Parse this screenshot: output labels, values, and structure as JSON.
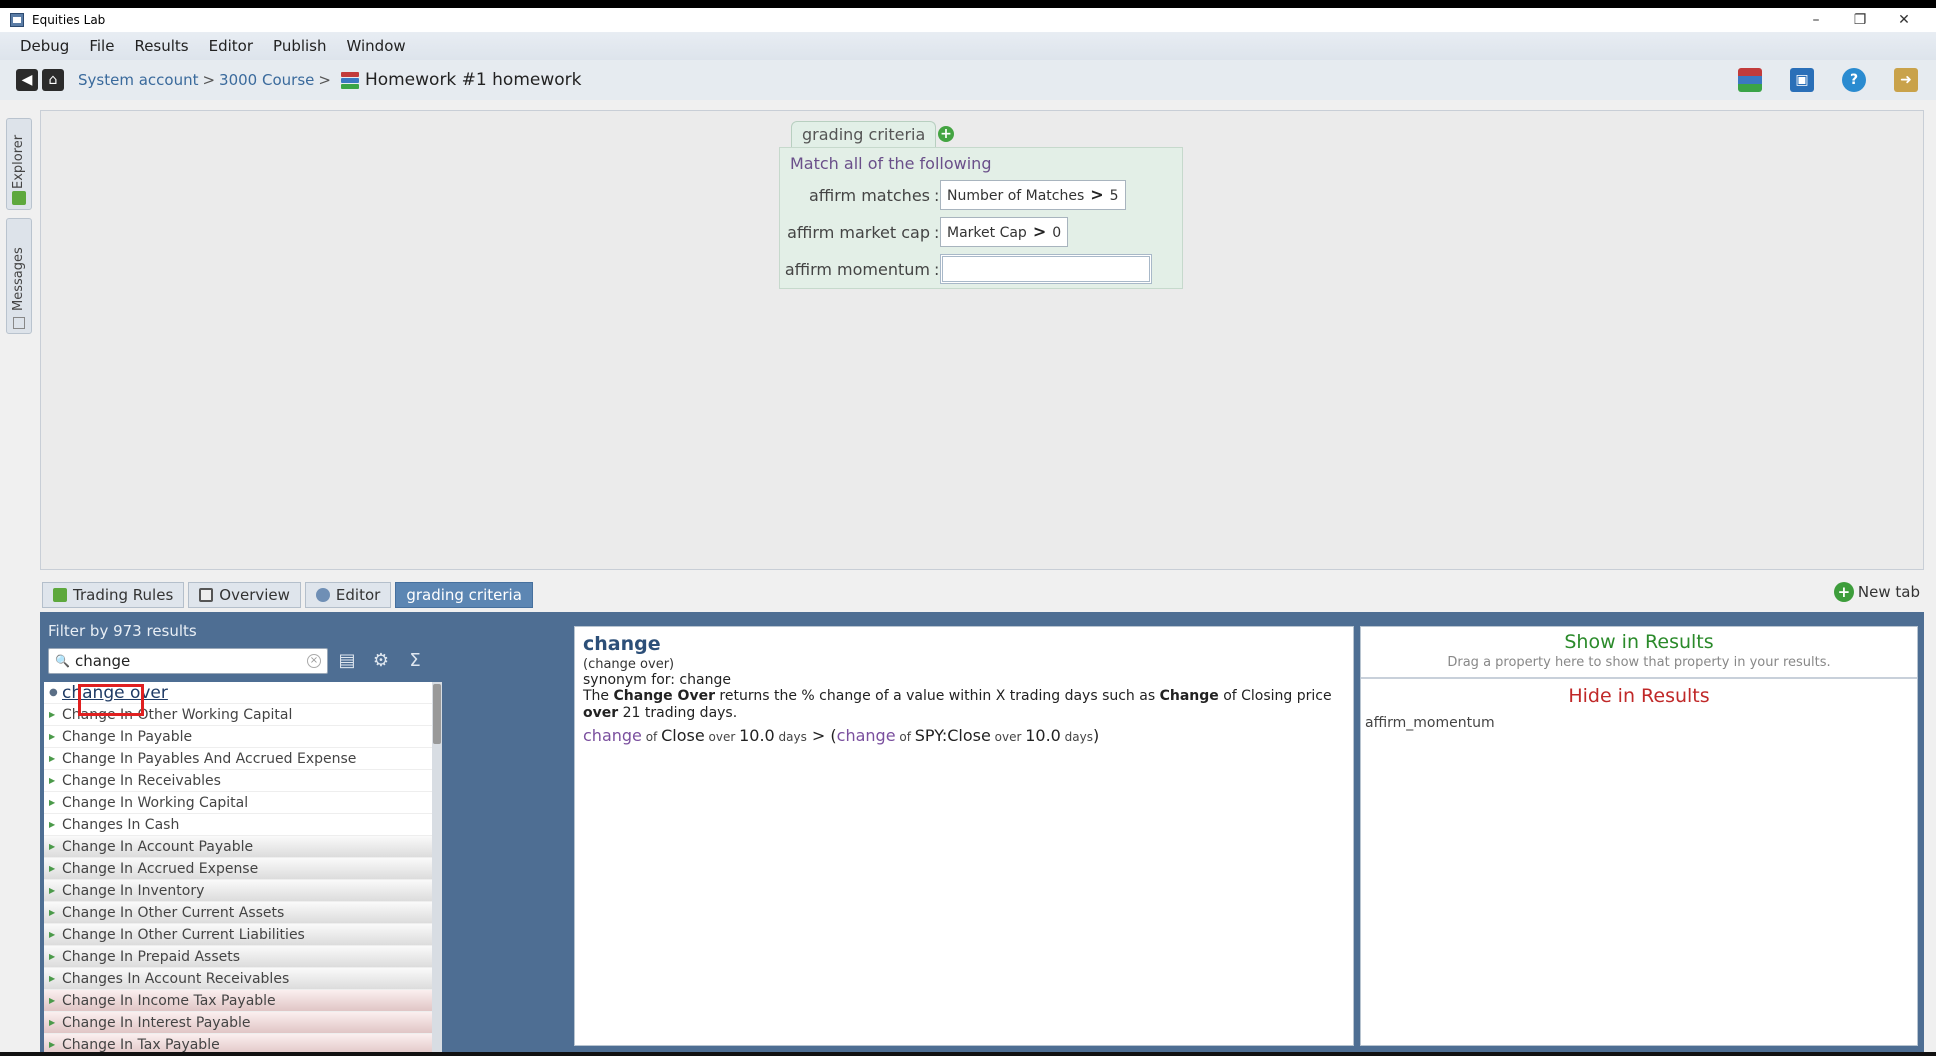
{
  "window": {
    "title": "Equities Lab",
    "minimize": "–",
    "restore": "❐",
    "close": "✕"
  },
  "menu": [
    "Debug",
    "File",
    "Results",
    "Editor",
    "Publish",
    "Window"
  ],
  "breadcrumb": {
    "part1": "System account",
    "sep1": ">",
    "part2": "3000 Course",
    "sep2": ">",
    "current": "Homework #1 homework"
  },
  "vtabs": {
    "explorer": "Explorer",
    "messages": "Messages"
  },
  "criteria": {
    "tab_label": "grading criteria",
    "header": "Match all of the following",
    "rows": [
      {
        "label": "affirm matches",
        "field": "Number of Matches",
        "op": ">",
        "value": "5"
      },
      {
        "label": "affirm market cap",
        "field": "Market Cap",
        "op": ">",
        "value": "0"
      },
      {
        "label": "affirm momentum",
        "field": "",
        "op": "",
        "value": ""
      }
    ]
  },
  "bottom_tabs": [
    "Trading Rules",
    "Overview",
    "Editor",
    "grading criteria"
  ],
  "new_tab": "New tab",
  "filter": {
    "title": "Filter by 973 results",
    "search_value": "change",
    "items": [
      "change over",
      "Change In Other Working Capital",
      "Change In Payable",
      "Change In Payables And Accrued Expense",
      "Change In Receivables",
      "Change In Working Capital",
      "Changes In Cash",
      "Change In Account Payable",
      "Change In Accrued Expense",
      "Change In Inventory",
      "Change In Other Current Assets",
      "Change In Other Current Liabilities",
      "Change In Prepaid Assets",
      "Changes In Account Receivables",
      "Change In Income Tax Payable",
      "Change In Interest Payable",
      "Change In Tax Payable"
    ]
  },
  "description": {
    "title": "change",
    "subtitle": "(change over)",
    "synonym": "synonym for: change",
    "text_pre": "The ",
    "text_bold1": "Change Over",
    "text_mid": " returns the % change of a value within X trading days such as ",
    "text_bold2": "Change",
    "text_mid2": " of Closing price ",
    "text_bold3": "over",
    "text_end": " 21 trading days.",
    "ex_k1": "change",
    "ex_of1": " of ",
    "ex_close": "Close",
    "ex_over1": " over ",
    "ex_n1": "10.0",
    "ex_days1": " days",
    "ex_gt": " > (",
    "ex_k2": "change",
    "ex_of2": " of ",
    "ex_spy": "SPY:Close",
    "ex_over2": " over ",
    "ex_n2": "10.0",
    "ex_days2": " days",
    "ex_close_paren": ")"
  },
  "results": {
    "show_title": "Show in Results",
    "show_hint": "Drag a property here to show that property in your results.",
    "hide_title": "Hide in Results",
    "hidden_items": [
      "affirm_momentum"
    ]
  }
}
